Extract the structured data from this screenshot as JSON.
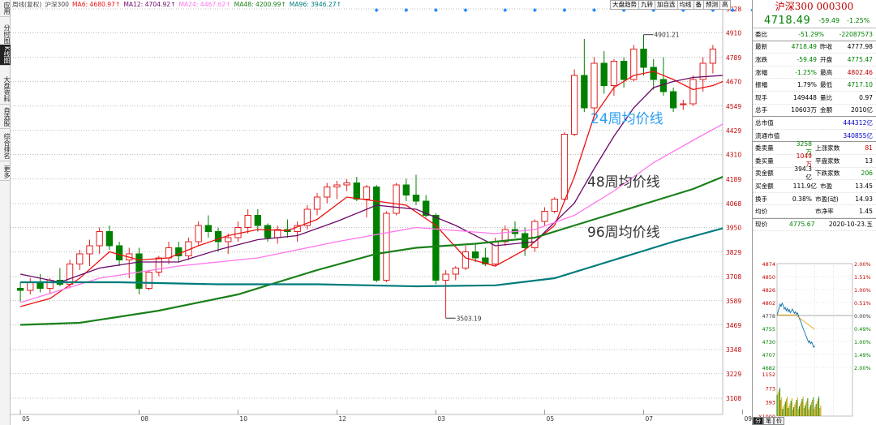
{
  "left_tabs": [
    {
      "label": "应用",
      "active": false
    },
    {
      "label": "分时图",
      "active": false
    },
    {
      "label": "K线图",
      "active": true
    },
    {
      "label": "大盘资料",
      "active": false
    },
    {
      "label": "自选股",
      "active": false
    },
    {
      "label": "综合排名",
      "active": false
    },
    {
      "label": "更多",
      "active": false
    }
  ],
  "legend": {
    "period_label": "周线(复权)",
    "name": "沪深300",
    "ma6": "MA6: 4680.97↑",
    "ma12": "MA12: 4704.92↑",
    "ma24": "MA24: 4467.62↑",
    "ma48": "MA48: 4200.99↑",
    "ma96": "MA96: 3946.27↑"
  },
  "toolbar": [
    "大盘趋势",
    "九转",
    "加自选",
    "均线",
    "备",
    "预测",
    "高"
  ],
  "colors": {
    "up": "#e02020",
    "down": "#008000",
    "ma6": "#ee1111",
    "ma12": "#6a0a6a",
    "ma24": "#ff77ee",
    "ma48": "#1a801a",
    "ma96": "#007b7b",
    "dividend_marker": "#2288ff"
  },
  "annotations": {
    "ma24_label": "24周均价线",
    "ma48_label": "48周均价线",
    "ma96_label": "96周均价线",
    "high_mark": "4901.21",
    "low_mark": "3503.19"
  },
  "chart_data": {
    "type": "candlestick",
    "ylim": [
      3108,
      5028
    ],
    "y_ticks": [
      5028,
      4910,
      4789,
      4670,
      4549,
      4429,
      4310,
      4189,
      4068,
      3950,
      3829,
      3708,
      3589,
      3469,
      3348,
      3229,
      3108
    ],
    "x_ticks": [
      "05",
      "08",
      "10",
      "12",
      "03",
      "05",
      "07",
      "09"
    ],
    "x_tick_index": [
      0,
      12,
      22,
      32,
      42,
      53,
      63,
      73
    ],
    "dividend_marker_index": [
      36,
      39,
      42,
      45,
      49,
      52,
      55,
      58,
      61,
      64,
      67,
      70,
      72,
      74
    ],
    "candles": [
      [
        3650,
        3680,
        3585,
        3640
      ],
      [
        3640,
        3700,
        3620,
        3680
      ],
      [
        3680,
        3720,
        3630,
        3650
      ],
      [
        3650,
        3700,
        3620,
        3690
      ],
      [
        3690,
        3750,
        3660,
        3670
      ],
      [
        3670,
        3790,
        3650,
        3770
      ],
      [
        3770,
        3840,
        3740,
        3820
      ],
      [
        3820,
        3890,
        3760,
        3860
      ],
      [
        3860,
        3950,
        3820,
        3930
      ],
      [
        3930,
        3960,
        3840,
        3860
      ],
      [
        3860,
        3880,
        3760,
        3790
      ],
      [
        3790,
        3850,
        3700,
        3820
      ],
      [
        3820,
        3850,
        3620,
        3650
      ],
      [
        3650,
        3740,
        3640,
        3730
      ],
      [
        3730,
        3810,
        3710,
        3800
      ],
      [
        3800,
        3880,
        3770,
        3850
      ],
      [
        3850,
        3880,
        3780,
        3810
      ],
      [
        3810,
        3900,
        3790,
        3880
      ],
      [
        3880,
        3980,
        3860,
        3960
      ],
      [
        3960,
        4010,
        3900,
        3930
      ],
      [
        3930,
        3950,
        3830,
        3880
      ],
      [
        3880,
        3920,
        3820,
        3900
      ],
      [
        3900,
        3980,
        3880,
        3950
      ],
      [
        3950,
        4040,
        3920,
        4010
      ],
      [
        4010,
        4040,
        3930,
        3960
      ],
      [
        3960,
        3970,
        3880,
        3900
      ],
      [
        3900,
        3960,
        3870,
        3940
      ],
      [
        3940,
        3990,
        3900,
        3930
      ],
      [
        3930,
        3980,
        3880,
        3960
      ],
      [
        3960,
        4060,
        3940,
        4040
      ],
      [
        4040,
        4120,
        4010,
        4100
      ],
      [
        4100,
        4170,
        4070,
        4150
      ],
      [
        4150,
        4180,
        4090,
        4160
      ],
      [
        4160,
        4190,
        4130,
        4170
      ],
      [
        4170,
        4200,
        4080,
        4090
      ],
      [
        4090,
        4160,
        4000,
        4150
      ],
      [
        4150,
        4160,
        3680,
        3690
      ],
      [
        3690,
        4030,
        3680,
        4020
      ],
      [
        4020,
        4170,
        4010,
        4160
      ],
      [
        4160,
        4190,
        4080,
        4110
      ],
      [
        4110,
        4210,
        4060,
        4080
      ],
      [
        4080,
        4110,
        4000,
        4010
      ],
      [
        4010,
        4020,
        3670,
        3690
      ],
      [
        3690,
        3740,
        3503,
        3720
      ],
      [
        3720,
        3760,
        3690,
        3750
      ],
      [
        3750,
        3860,
        3740,
        3830
      ],
      [
        3830,
        3870,
        3780,
        3800
      ],
      [
        3800,
        3850,
        3760,
        3770
      ],
      [
        3770,
        3900,
        3760,
        3880
      ],
      [
        3880,
        3960,
        3860,
        3940
      ],
      [
        3940,
        3980,
        3900,
        3920
      ],
      [
        3920,
        3950,
        3810,
        3850
      ],
      [
        3850,
        3990,
        3830,
        3980
      ],
      [
        3980,
        4050,
        3960,
        4030
      ],
      [
        4030,
        4100,
        4020,
        4090
      ],
      [
        4090,
        4420,
        4080,
        4410
      ],
      [
        4410,
        4730,
        4400,
        4700
      ],
      [
        4700,
        4880,
        4520,
        4540
      ],
      [
        4540,
        4790,
        4490,
        4760
      ],
      [
        4760,
        4820,
        4610,
        4650
      ],
      [
        4650,
        4780,
        4600,
        4770
      ],
      [
        4770,
        4790,
        4640,
        4680
      ],
      [
        4680,
        4850,
        4670,
        4830
      ],
      [
        4830,
        4901.21,
        4700,
        4740
      ],
      [
        4740,
        4780,
        4630,
        4680
      ],
      [
        4680,
        4790,
        4600,
        4620
      ],
      [
        4620,
        4640,
        4520,
        4540
      ],
      [
        4560,
        4580,
        4530,
        4560
      ],
      [
        4560,
        4700,
        4550,
        4680
      ],
      [
        4680,
        4790,
        4620,
        4760
      ],
      [
        4760,
        4850,
        4710,
        4830
      ]
    ],
    "series": [
      {
        "key": "ma6",
        "values": [
          [
            0,
            3560
          ],
          [
            3,
            3600
          ],
          [
            6,
            3700
          ],
          [
            9,
            3830
          ],
          [
            12,
            3790
          ],
          [
            15,
            3800
          ],
          [
            18,
            3860
          ],
          [
            21,
            3910
          ],
          [
            24,
            3940
          ],
          [
            27,
            3935
          ],
          [
            30,
            3990
          ],
          [
            33,
            4100
          ],
          [
            36,
            4080
          ],
          [
            39,
            4060
          ],
          [
            42,
            3960
          ],
          [
            45,
            3800
          ],
          [
            48,
            3760
          ],
          [
            51,
            3840
          ],
          [
            54,
            3960
          ],
          [
            56,
            4200
          ],
          [
            58,
            4500
          ],
          [
            60,
            4640
          ],
          [
            62,
            4700
          ],
          [
            64,
            4720
          ],
          [
            66,
            4680
          ],
          [
            68,
            4630
          ],
          [
            70,
            4650
          ],
          [
            71,
            4670
          ]
        ]
      },
      {
        "key": "ma12",
        "values": [
          [
            0,
            3720
          ],
          [
            4,
            3680
          ],
          [
            8,
            3750
          ],
          [
            12,
            3780
          ],
          [
            16,
            3780
          ],
          [
            20,
            3840
          ],
          [
            24,
            3890
          ],
          [
            28,
            3910
          ],
          [
            32,
            3980
          ],
          [
            36,
            4060
          ],
          [
            40,
            4040
          ],
          [
            44,
            3960
          ],
          [
            48,
            3860
          ],
          [
            52,
            3880
          ],
          [
            56,
            4070
          ],
          [
            58,
            4240
          ],
          [
            60,
            4400
          ],
          [
            62,
            4540
          ],
          [
            64,
            4640
          ],
          [
            66,
            4670
          ],
          [
            68,
            4690
          ],
          [
            71,
            4700
          ]
        ]
      },
      {
        "key": "ma24",
        "values": [
          [
            0,
            3580
          ],
          [
            8,
            3700
          ],
          [
            16,
            3760
          ],
          [
            24,
            3800
          ],
          [
            32,
            3880
          ],
          [
            40,
            3950
          ],
          [
            48,
            3920
          ],
          [
            52,
            3940
          ],
          [
            56,
            4010
          ],
          [
            60,
            4130
          ],
          [
            64,
            4270
          ],
          [
            68,
            4380
          ],
          [
            71,
            4460
          ]
        ]
      },
      {
        "key": "ma48",
        "values": [
          [
            0,
            3470
          ],
          [
            6,
            3480
          ],
          [
            14,
            3540
          ],
          [
            22,
            3620
          ],
          [
            30,
            3740
          ],
          [
            36,
            3820
          ],
          [
            40,
            3850
          ],
          [
            46,
            3870
          ],
          [
            52,
            3900
          ],
          [
            56,
            3960
          ],
          [
            60,
            4020
          ],
          [
            64,
            4080
          ],
          [
            68,
            4140
          ],
          [
            71,
            4200
          ]
        ]
      },
      {
        "key": "ma96",
        "values": [
          [
            0,
            3680
          ],
          [
            10,
            3680
          ],
          [
            20,
            3670
          ],
          [
            30,
            3670
          ],
          [
            40,
            3660
          ],
          [
            48,
            3665
          ],
          [
            54,
            3700
          ],
          [
            58,
            3760
          ],
          [
            62,
            3820
          ],
          [
            66,
            3880
          ],
          [
            71,
            3946
          ]
        ]
      }
    ]
  },
  "quote": {
    "title": "沪深300 000300",
    "price": "4718.49",
    "change": "-59.49",
    "pct": "-1.25%",
    "rows": [
      {
        "l": "委比",
        "v": "-51.29%",
        "l2": "",
        "v2": "-22087573",
        "vc": "grn",
        "v2c": "grn"
      },
      {
        "l": "最新",
        "v": "4718.49",
        "l2": "昨收",
        "v2": "4777.98",
        "vc": "grn",
        "v2c": ""
      },
      {
        "l": "涨跌",
        "v": "-59.49",
        "l2": "开盘",
        "v2": "4775.47",
        "vc": "grn",
        "v2c": "grn"
      },
      {
        "l": "涨幅",
        "v": "-1.25%",
        "l2": "最高",
        "v2": "4802.46",
        "vc": "grn",
        "v2c": "red"
      },
      {
        "l": "振幅",
        "v": "1.79%",
        "l2": "最低",
        "v2": "4717.10",
        "vc": "",
        "v2c": "grn"
      },
      {
        "l": "现手",
        "v": "149448",
        "l2": "量比",
        "v2": "0.97",
        "vc": "",
        "v2c": ""
      },
      {
        "l": "总手",
        "v": "10603万",
        "l2": "金额",
        "v2": "2010亿",
        "vc": "",
        "v2c": ""
      },
      {
        "l": "总市值",
        "v": "444312亿",
        "l2": "",
        "v2": "",
        "vc": "blu",
        "v2c": ""
      },
      {
        "l": "流通市值",
        "v": "340855亿",
        "l2": "",
        "v2": "",
        "vc": "blu",
        "v2c": ""
      },
      {
        "l": "委卖量",
        "v": "3258万",
        "l2": "上涨家数",
        "v2": "81",
        "vc": "grn",
        "v2c": "red"
      },
      {
        "l": "委买量",
        "v": "1049万",
        "l2": "平盘家数",
        "v2": "13",
        "vc": "red",
        "v2c": ""
      },
      {
        "l": "卖金额",
        "v": "394.3亿",
        "l2": "下跌家数",
        "v2": "206",
        "vc": "",
        "v2c": "grn"
      },
      {
        "l": "买金额",
        "v": "111.9亿",
        "l2": "市盈",
        "v2": "13.45",
        "vc": "",
        "v2c": ""
      },
      {
        "l": "换手",
        "v": "0.38%",
        "l2": "市盈(动)",
        "v2": "14.93",
        "vc": "",
        "v2c": ""
      },
      {
        "l": "均价",
        "v": "",
        "l2": "市净率",
        "v2": "1.45",
        "vc": "",
        "v2c": ""
      }
    ],
    "now_label": "现价",
    "now_value": "4775.67",
    "date": "2020-10-23.五"
  },
  "intraday": {
    "prices": [
      "4874",
      "4850",
      "4826",
      "4802",
      "4778",
      "4755",
      "4730",
      "4707",
      "4682"
    ],
    "pcts": [
      "2.00%",
      "1.51%",
      "1.00%",
      "0.51%",
      "0.00%",
      "0.49%",
      "1.00%",
      "1.49%",
      "2.00%"
    ],
    "vol_ticks": [
      "1152",
      "773",
      "393",
      "X1000"
    ],
    "path": [
      4778,
      4785,
      4792,
      4799,
      4795,
      4801,
      4797,
      4790,
      4793,
      4787,
      4791,
      4785,
      4789,
      4783,
      4786,
      4790,
      4786,
      4782,
      4785,
      4780,
      4783,
      4778,
      4772,
      4768,
      4763,
      4757,
      4752,
      4748,
      4742,
      4738,
      4733,
      4728,
      4731,
      4726,
      4729,
      4724,
      4719,
      4722
    ]
  },
  "bottom_tabs": [
    "分",
    "笔",
    "价"
  ]
}
